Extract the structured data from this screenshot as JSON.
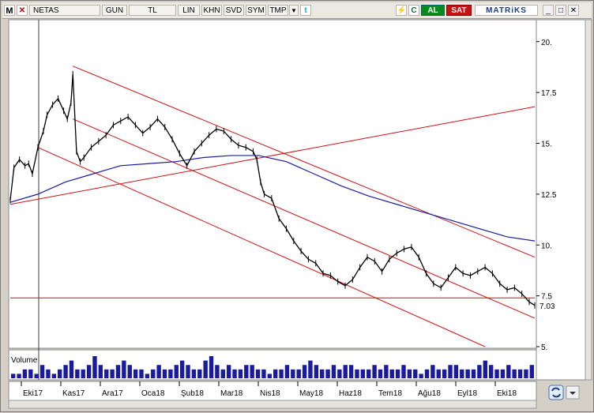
{
  "toolbar": {
    "logo": "M",
    "close_glyph": "✕",
    "symbol": "NETAS",
    "period": "GUN",
    "currency": "TL",
    "scale": "LIN",
    "btn_khn": "KHN",
    "btn_svd": "SVD",
    "btn_sym": "SYM",
    "btn_tmp": "TMP",
    "dropdown_glyph": "▼",
    "twitter_glyph": "t",
    "flash_glyph": "⚡",
    "refresh_glyph": "C",
    "buy_label": "AL",
    "sell_label": "SAT",
    "brand": "MATRiKS",
    "min_glyph": "_",
    "max_glyph": "□",
    "win_close_glyph": "✕"
  },
  "colors": {
    "price": "#000000",
    "ma": "#1a1aa0",
    "trendline": "#d01010",
    "volume": "#1a1aa0",
    "background": "#ffffff",
    "frame": "#d4d0c8"
  },
  "volume_label": "Volume",
  "last_price_label": "7.03",
  "bottom_icon": "refresh-icon",
  "chart_data": {
    "type": "line",
    "title": "",
    "symbol": "NETAS",
    "ylim": [
      5,
      21
    ],
    "y_ticks": [
      "20.",
      "17.5",
      "15.",
      "12.5",
      "10.",
      "7.5",
      "5."
    ],
    "x_labels": [
      "Eki17",
      "Kas17",
      "Ara17",
      "Oca18",
      "Şub18",
      "Mar18",
      "Nis18",
      "May18",
      "Haz18",
      "Tem18",
      "Ağu18",
      "Eyl18",
      "Eki18"
    ],
    "scale": "linear",
    "series": [
      {
        "type": "close",
        "points": [
          [
            0,
            12.2
          ],
          [
            2,
            13.8
          ],
          [
            5,
            14.2
          ],
          [
            8,
            13.9
          ],
          [
            10,
            14.0
          ],
          [
            12,
            13.5
          ],
          [
            15,
            14.8
          ],
          [
            18,
            15.6
          ],
          [
            20,
            16.4
          ],
          [
            23,
            16.9
          ],
          [
            26,
            17.2
          ],
          [
            29,
            16.6
          ],
          [
            31,
            16.2
          ],
          [
            33,
            17.0
          ],
          [
            34,
            18.4
          ],
          [
            35,
            16.5
          ],
          [
            36,
            14.6
          ],
          [
            38,
            14.1
          ],
          [
            40,
            14.3
          ],
          [
            44,
            14.8
          ],
          [
            48,
            15.1
          ],
          [
            52,
            15.4
          ],
          [
            56,
            15.9
          ],
          [
            60,
            16.1
          ],
          [
            64,
            16.3
          ],
          [
            68,
            15.9
          ],
          [
            72,
            15.5
          ],
          [
            76,
            15.8
          ],
          [
            80,
            16.2
          ],
          [
            84,
            15.8
          ],
          [
            88,
            15.2
          ],
          [
            92,
            14.5
          ],
          [
            96,
            13.9
          ],
          [
            100,
            14.6
          ],
          [
            104,
            15.0
          ],
          [
            108,
            15.4
          ],
          [
            112,
            15.7
          ],
          [
            116,
            15.6
          ],
          [
            120,
            15.2
          ],
          [
            124,
            14.9
          ],
          [
            128,
            14.8
          ],
          [
            132,
            14.6
          ],
          [
            134,
            14.2
          ],
          [
            136,
            13.1
          ],
          [
            138,
            12.5
          ],
          [
            142,
            12.3
          ],
          [
            146,
            11.3
          ],
          [
            150,
            10.8
          ],
          [
            154,
            10.2
          ],
          [
            158,
            9.7
          ],
          [
            162,
            9.3
          ],
          [
            166,
            9.1
          ],
          [
            170,
            8.6
          ],
          [
            174,
            8.5
          ],
          [
            178,
            8.2
          ],
          [
            182,
            8.0
          ],
          [
            186,
            8.3
          ],
          [
            190,
            8.9
          ],
          [
            194,
            9.4
          ],
          [
            198,
            9.2
          ],
          [
            202,
            8.7
          ],
          [
            206,
            9.3
          ],
          [
            210,
            9.6
          ],
          [
            214,
            9.8
          ],
          [
            218,
            9.9
          ],
          [
            222,
            9.4
          ],
          [
            226,
            8.6
          ],
          [
            230,
            8.1
          ],
          [
            234,
            7.9
          ],
          [
            238,
            8.4
          ],
          [
            242,
            8.9
          ],
          [
            246,
            8.6
          ],
          [
            250,
            8.5
          ],
          [
            254,
            8.7
          ],
          [
            258,
            8.9
          ],
          [
            262,
            8.6
          ],
          [
            266,
            8.1
          ],
          [
            270,
            7.8
          ],
          [
            274,
            7.9
          ],
          [
            278,
            7.6
          ],
          [
            282,
            7.2
          ],
          [
            285,
            7.03
          ]
        ]
      },
      {
        "type": "moving-average",
        "points": [
          [
            0,
            12.1
          ],
          [
            15,
            12.5
          ],
          [
            30,
            13.1
          ],
          [
            45,
            13.5
          ],
          [
            60,
            13.9
          ],
          [
            75,
            14.0
          ],
          [
            90,
            14.1
          ],
          [
            105,
            14.3
          ],
          [
            120,
            14.4
          ],
          [
            135,
            14.4
          ],
          [
            150,
            14.1
          ],
          [
            165,
            13.5
          ],
          [
            180,
            12.9
          ],
          [
            195,
            12.4
          ],
          [
            210,
            12.0
          ],
          [
            225,
            11.6
          ],
          [
            240,
            11.2
          ],
          [
            255,
            10.8
          ],
          [
            270,
            10.4
          ],
          [
            285,
            10.2
          ]
        ]
      },
      {
        "type": "volume",
        "values": [
          1,
          1,
          2,
          2,
          1,
          3,
          2,
          1,
          2,
          3,
          4,
          2,
          2,
          3,
          5,
          3,
          2,
          2,
          3,
          4,
          3,
          2,
          2,
          1,
          2,
          3,
          2,
          2,
          3,
          4,
          3,
          2,
          2,
          4,
          5,
          3,
          2,
          3,
          2,
          2,
          3,
          3,
          2,
          2,
          1,
          2,
          2,
          3,
          2,
          2,
          3,
          4,
          3,
          2,
          2,
          3,
          2,
          3,
          3,
          2,
          2,
          2,
          3,
          2,
          3,
          2,
          2,
          3,
          2,
          2,
          1,
          2,
          3,
          2,
          2,
          3,
          3,
          2,
          2,
          2,
          3,
          4,
          3,
          2,
          2,
          3,
          2,
          2,
          2,
          3
        ]
      }
    ],
    "trendlines": [
      {
        "from": [
          34,
          18.8
        ],
        "to": [
          285,
          9.4
        ]
      },
      {
        "from": [
          34,
          16.2
        ],
        "to": [
          285,
          6.4
        ]
      },
      {
        "from": [
          15,
          14.8
        ],
        "to": [
          258,
          5.0
        ]
      },
      {
        "from": [
          0,
          12.0
        ],
        "to": [
          285,
          16.8
        ]
      },
      {
        "from": [
          0,
          7.4
        ],
        "to": [
          285,
          7.4
        ]
      }
    ]
  }
}
